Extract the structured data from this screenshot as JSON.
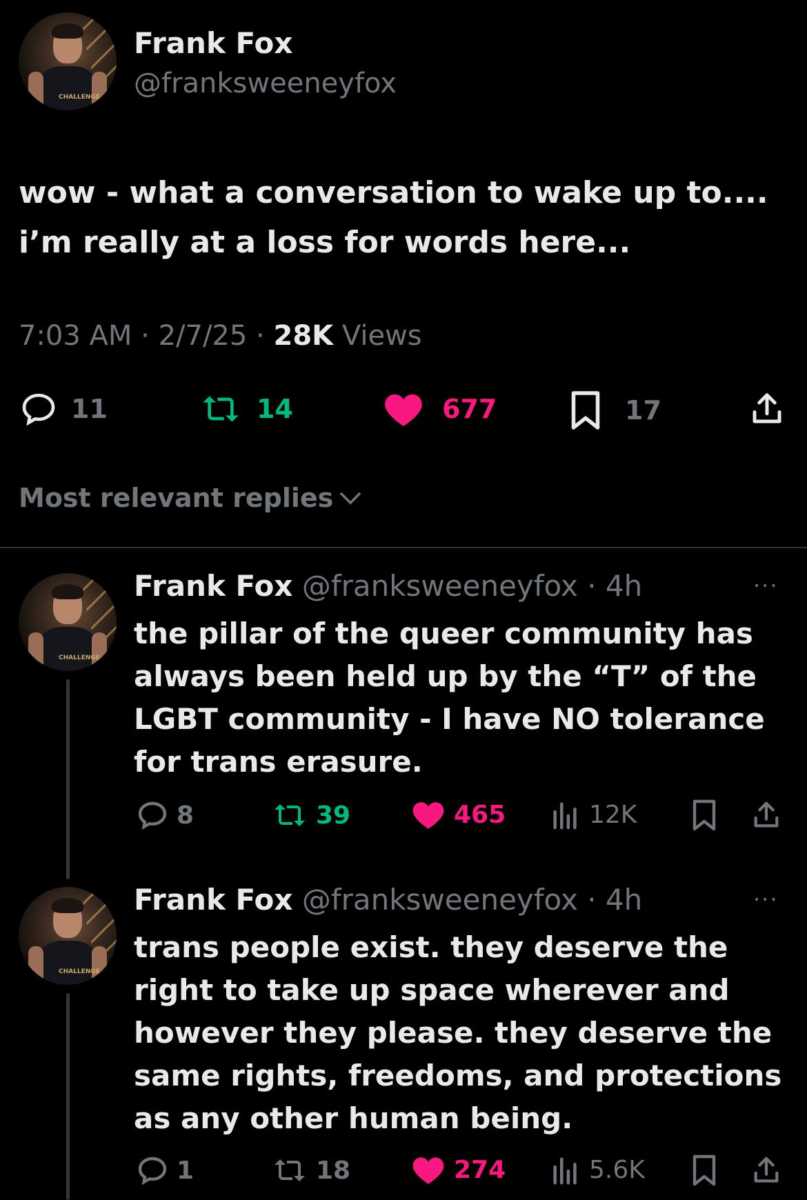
{
  "main_tweet": {
    "author_name": "Frank Fox",
    "handle": "@franksweeneyfox",
    "text": "wow - what a conversation to wake up to.... i’m really at a loss for words here...",
    "time": "7:03 AM",
    "date": "2/7/25",
    "sep": "·",
    "views_count": "28K",
    "views_label": "Views",
    "replies": "11",
    "reposts": "14",
    "likes": "677",
    "bookmarks": "17",
    "avatar_logo": "CHALLENGE"
  },
  "sort_label": "Most relevant replies",
  "replies": [
    {
      "author_name": "Frank Fox",
      "handle": "@franksweeneyfox",
      "time": "· 4h",
      "more": "···",
      "text": "the pillar of the queer community has always been held up by the “T” of the LGBT community - I have NO tolerance for trans erasure.",
      "replies": "8",
      "reposts": "39",
      "likes": "465",
      "views": "12K",
      "avatar_logo": "CHALLENGE"
    },
    {
      "author_name": "Frank Fox",
      "handle": "@franksweeneyfox",
      "time": "· 4h",
      "more": "···",
      "text": "trans people exist. they deserve the right to take up space wherever and however they please. they deserve the same rights, freedoms, and protections as any other human being.",
      "replies": "1",
      "reposts": "18",
      "likes": "274",
      "views": "5.6K",
      "avatar_logo": "CHALLENGE"
    }
  ],
  "colors": {
    "background": "#000000",
    "text": "#e7e9ea",
    "muted": "#71767b",
    "repost": "#00ba7c",
    "like": "#f91880"
  }
}
